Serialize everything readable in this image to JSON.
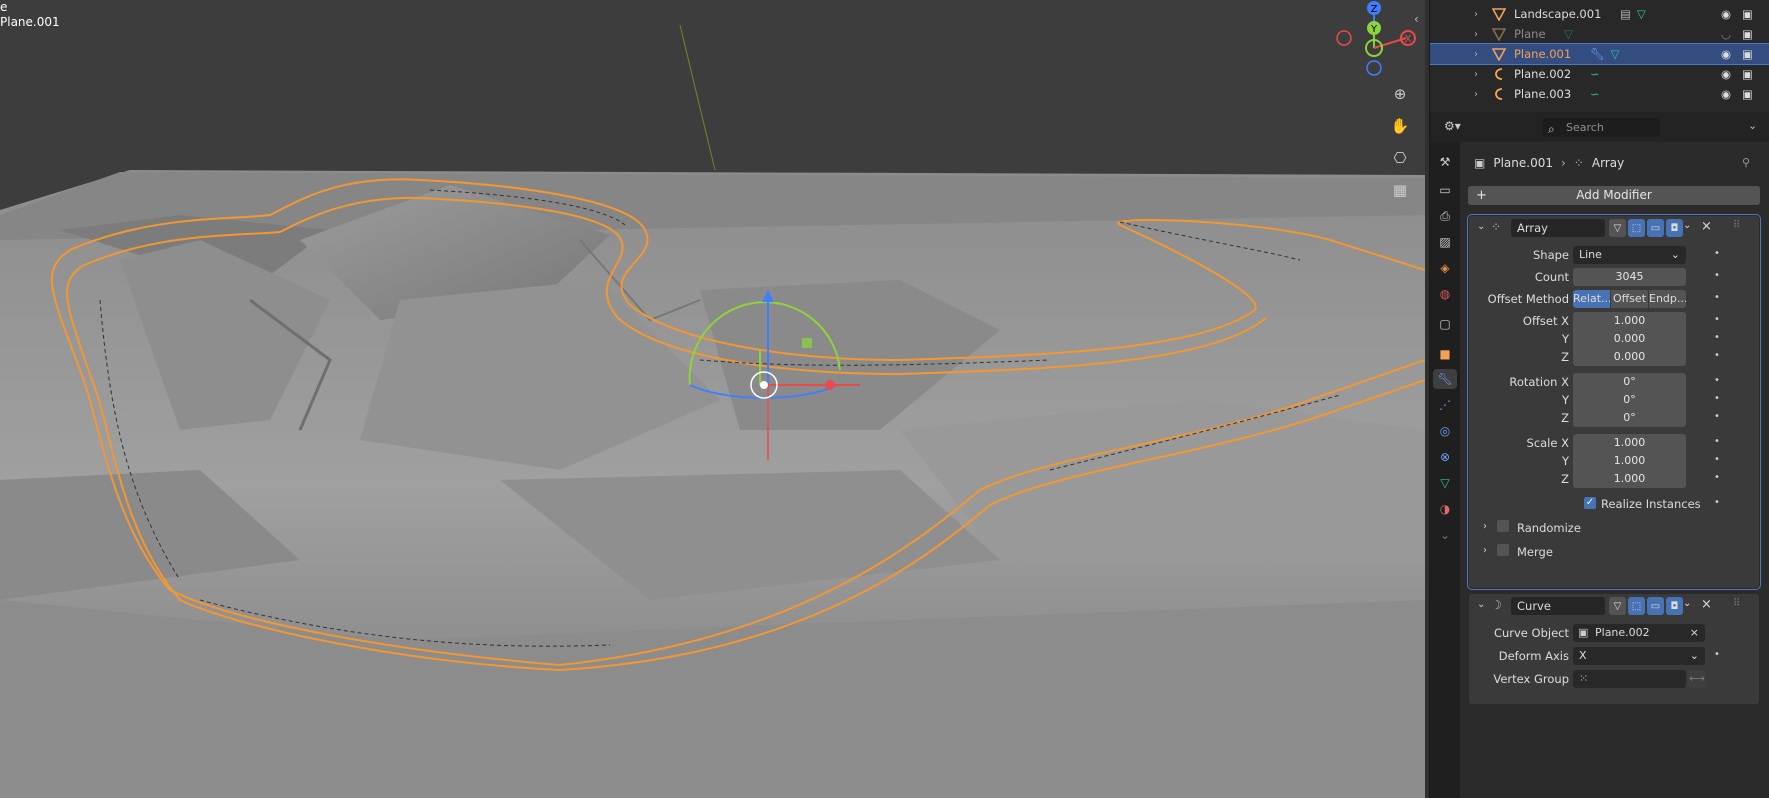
{
  "viewport": {
    "top_label_1": "e",
    "top_label_2": "Plane.001",
    "gizmo": {
      "z": "Z",
      "y": "Y",
      "x": "X"
    }
  },
  "outliner": {
    "rows": [
      {
        "name": "Landscape.001"
      },
      {
        "name": "Plane"
      },
      {
        "name": "Plane.001"
      },
      {
        "name": "Plane.002"
      },
      {
        "name": "Plane.003"
      }
    ]
  },
  "properties": {
    "search_placeholder": "Search",
    "breadcrumb_object": "Plane.001",
    "breadcrumb_modifier": "Array",
    "add_modifier_label": "Add Modifier",
    "array": {
      "name": "Array",
      "shape_label": "Shape",
      "shape_value": "Line",
      "count_label": "Count",
      "count_value": "3045",
      "offset_method_label": "Offset Method",
      "offset_method_options": [
        "Relat...",
        "Offset",
        "Endp..."
      ],
      "offset_x_label": "Offset X",
      "offset_x": "1.000",
      "offset_y_label": "Y",
      "offset_y": "0.000",
      "offset_z_label": "Z",
      "offset_z": "0.000",
      "rotation_x_label": "Rotation X",
      "rotation_x": "0°",
      "rotation_y_label": "Y",
      "rotation_y": "0°",
      "rotation_z_label": "Z",
      "rotation_z": "0°",
      "scale_x_label": "Scale X",
      "scale_x": "1.000",
      "scale_y_label": "Y",
      "scale_y": "1.000",
      "scale_z_label": "Z",
      "scale_z": "1.000",
      "realize_label": "Realize Instances",
      "randomize_label": "Randomize",
      "merge_label": "Merge"
    },
    "curve": {
      "name": "Curve",
      "curve_object_label": "Curve Object",
      "curve_object_value": "Plane.002",
      "deform_axis_label": "Deform Axis",
      "deform_axis_value": "X",
      "vertex_group_label": "Vertex Group"
    }
  },
  "colors": {
    "accent": "#4772b3",
    "selection": "#f1a254",
    "viewport_bg": "#3d3d3d"
  }
}
